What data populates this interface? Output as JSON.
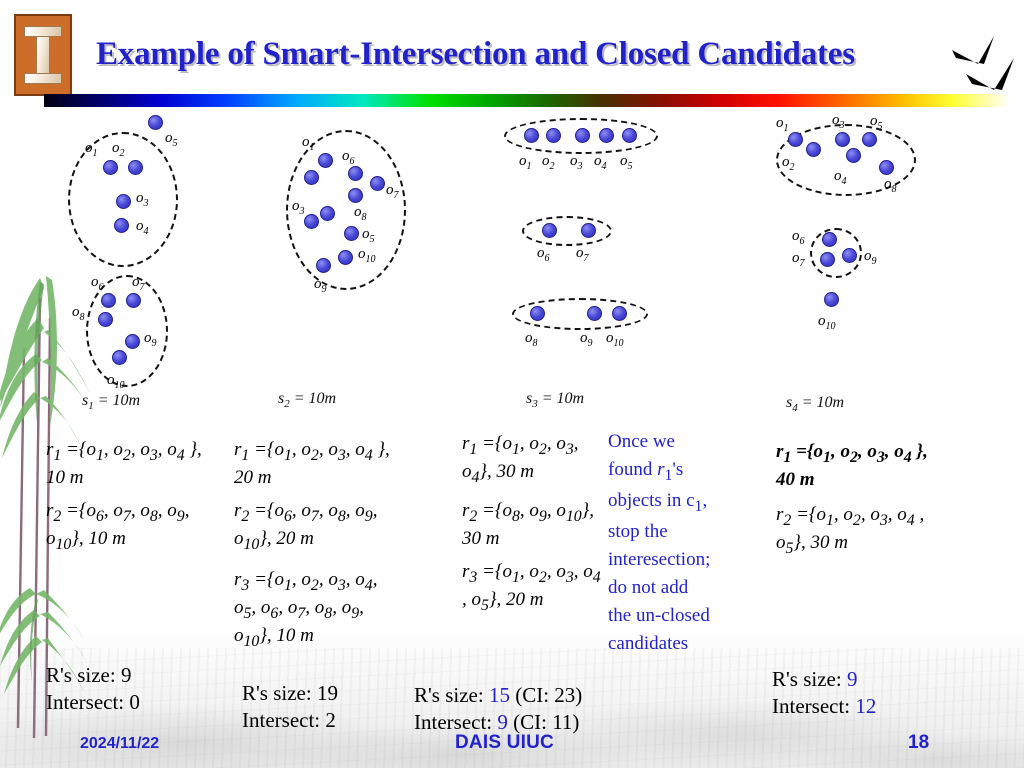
{
  "header": {
    "title": "Example of Smart-Intersection and Closed Candidates",
    "logo_alt": "uiuc-block-i-logo",
    "title_color": "#2222cc"
  },
  "footer": {
    "date": "2024/11/22",
    "org": "DAIS UIUC",
    "page_number": "18"
  },
  "diagrams": [
    {
      "id": "s1",
      "caption_prefix": "s",
      "caption_sub": "1",
      "caption_rest": " = 10m",
      "caption_full": "s1 = 10m",
      "points": [
        {
          "label": "o",
          "sub": "5"
        },
        {
          "label": "o",
          "sub": "1"
        },
        {
          "label": "o",
          "sub": "2"
        },
        {
          "label": "o",
          "sub": "3"
        },
        {
          "label": "o",
          "sub": "4"
        },
        {
          "label": "o",
          "sub": "6"
        },
        {
          "label": "o",
          "sub": "7"
        },
        {
          "label": "o",
          "sub": "8"
        },
        {
          "label": "o",
          "sub": "9"
        },
        {
          "label": "o",
          "sub": "10"
        }
      ]
    },
    {
      "id": "s2",
      "caption_full": "s2 = 10m",
      "points": [
        {
          "label": "o",
          "sub": "1"
        },
        {
          "label": "o",
          "sub": "6"
        },
        {
          "label": "o",
          "sub": "7"
        },
        {
          "label": "o",
          "sub": "3"
        },
        {
          "label": "o",
          "sub": "8"
        },
        {
          "label": "o",
          "sub": "5"
        },
        {
          "label": "o",
          "sub": "10"
        },
        {
          "label": "o",
          "sub": "9"
        }
      ]
    },
    {
      "id": "s3",
      "caption_full": "s3 = 10m",
      "points": [
        {
          "label": "o",
          "sub": "1"
        },
        {
          "label": "o",
          "sub": "2"
        },
        {
          "label": "o",
          "sub": "3"
        },
        {
          "label": "o",
          "sub": "4"
        },
        {
          "label": "o",
          "sub": "5"
        },
        {
          "label": "o",
          "sub": "6"
        },
        {
          "label": "o",
          "sub": "7"
        },
        {
          "label": "o",
          "sub": "8"
        },
        {
          "label": "o",
          "sub": "9"
        },
        {
          "label": "o",
          "sub": "10"
        }
      ]
    },
    {
      "id": "s4",
      "caption_full": "s4 = 10m",
      "points": [
        {
          "label": "o",
          "sub": "1"
        },
        {
          "label": "o",
          "sub": "3"
        },
        {
          "label": "o",
          "sub": "5"
        },
        {
          "label": "o",
          "sub": "2"
        },
        {
          "label": "o",
          "sub": "4"
        },
        {
          "label": "o",
          "sub": "8"
        },
        {
          "label": "o",
          "sub": "6"
        },
        {
          "label": "o",
          "sub": "7"
        },
        {
          "label": "o",
          "sub": "9"
        },
        {
          "label": "o",
          "sub": "10"
        }
      ]
    }
  ],
  "column1": {
    "rules": [
      "r1 ={o1, o2, o3, o4 }, 10 m",
      "r2 ={o6, o7, o8, o9, o10}, 10 m"
    ],
    "size_label": "R's size:",
    "size_value": "9",
    "intersect_label": "Intersect:",
    "intersect_value": "0"
  },
  "column2": {
    "rules": [
      "r1 ={o1, o2, o3, o4 }, 20 m",
      "r2 ={o6, o7, o8, o9, o10}, 20 m",
      "r3 ={o1, o2, o3, o4, o5, o6, o7, o8, o9, o10}, 10 m"
    ],
    "size_label": "R's size:",
    "size_value": "19",
    "intersect_label": "Intersect:",
    "intersect_value": "2"
  },
  "column3": {
    "rules": [
      "r1 ={o1, o2, o3, o4}, 30 m",
      "r2 ={o8, o9, o10}, 30 m",
      "r3 ={o1, o2, o3, o4 , o5}, 20 m"
    ],
    "size_label": "R's size:",
    "size_value": "15",
    "size_ci": "(CI: 23)",
    "intersect_label": "Intersect:",
    "intersect_value": "9",
    "intersect_ci": "(CI: 11)"
  },
  "column4": {
    "rules": [
      "r1 ={o1, o2, o3, o4 }, 40 m",
      "r2 ={o1, o2, o3, o4 , o5}, 30 m"
    ],
    "size_label": "R's size:",
    "size_value": "9",
    "intersect_label": "Intersect:",
    "intersect_value": "12"
  },
  "note": {
    "lines": [
      "Once we",
      "found r1's",
      "objects in c1,",
      "stop the",
      "interesection;",
      "do not add",
      "the un-closed",
      "candidates"
    ],
    "color": "#2222cc"
  }
}
